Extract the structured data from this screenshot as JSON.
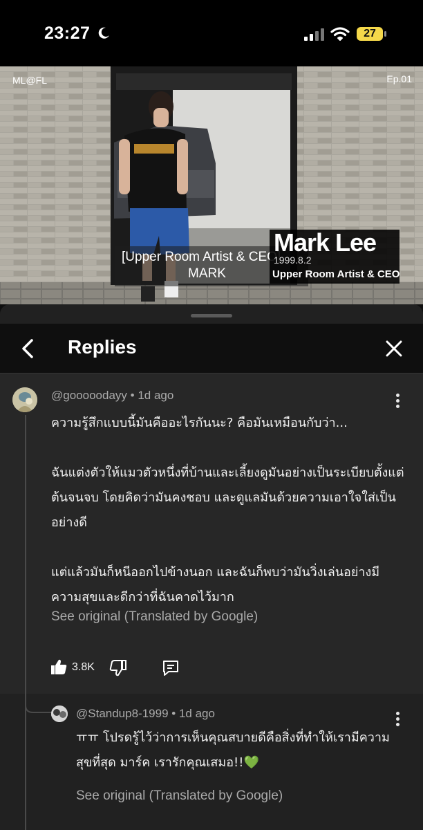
{
  "status_bar": {
    "time": "23:27",
    "battery": "27",
    "icons": [
      "moon-icon",
      "signal-icon",
      "wifi-icon",
      "battery-icon"
    ]
  },
  "video": {
    "brand_tag": "ML@FL",
    "episode_tag": "Ep.01",
    "subtitle_line1": "[Upper Room Artist & CEO]",
    "subtitle_line2": "MARK",
    "name_title": "Mark Lee",
    "name_date": "1999.8.2",
    "name_role": "Upper Room Artist & CEO"
  },
  "panel": {
    "title": "Replies",
    "back_icon": "chevron-left-icon",
    "close_icon": "close-icon"
  },
  "comment": {
    "author": "@gooooodayy",
    "time": "1d ago",
    "text": "ความรู้สึกแบบนี้มันคืออะไรกันนะ? คือมันเหมือนกับว่า...\n\nฉันแต่งตัวให้แมวตัวหนึ่งที่บ้านและเลี้ยงดูมันอย่างเป็นระเบียบตั้งแต่ต้นจนจบ โดยคิดว่ามันคงชอบ และดูแลมันด้วยความเอาใจใส่เป็นอย่างดี\n\nแต่แล้วมันก็หนีออกไปข้างนอก และฉันก็พบว่ามันวิ่งเล่นอย่างมีความสุขและดีกว่าที่ฉันคาดไว้มาก",
    "see_original": "See original (Translated by Google)",
    "likes": "3.8K",
    "actions": [
      "thumbs-up-icon",
      "thumbs-down-icon",
      "reply-icon"
    ]
  },
  "reply": {
    "author": "@Standup8-1999",
    "time": "1d ago",
    "text": "ㅠㅠ โปรดรู้ไว้ว่าการเห็นคุณสบายดีคือสิ่งที่ทำให้เรามีความสุขที่สุด มาร์ค เรารักคุณเสมอ!!💚",
    "see_original": "See original (Translated by Google)"
  },
  "colors": {
    "background": "#0f0f0f",
    "panel": "#212121",
    "highlighted_comment": "#272727",
    "secondary_text": "#aaaaaa",
    "battery": "#f5d84a"
  }
}
